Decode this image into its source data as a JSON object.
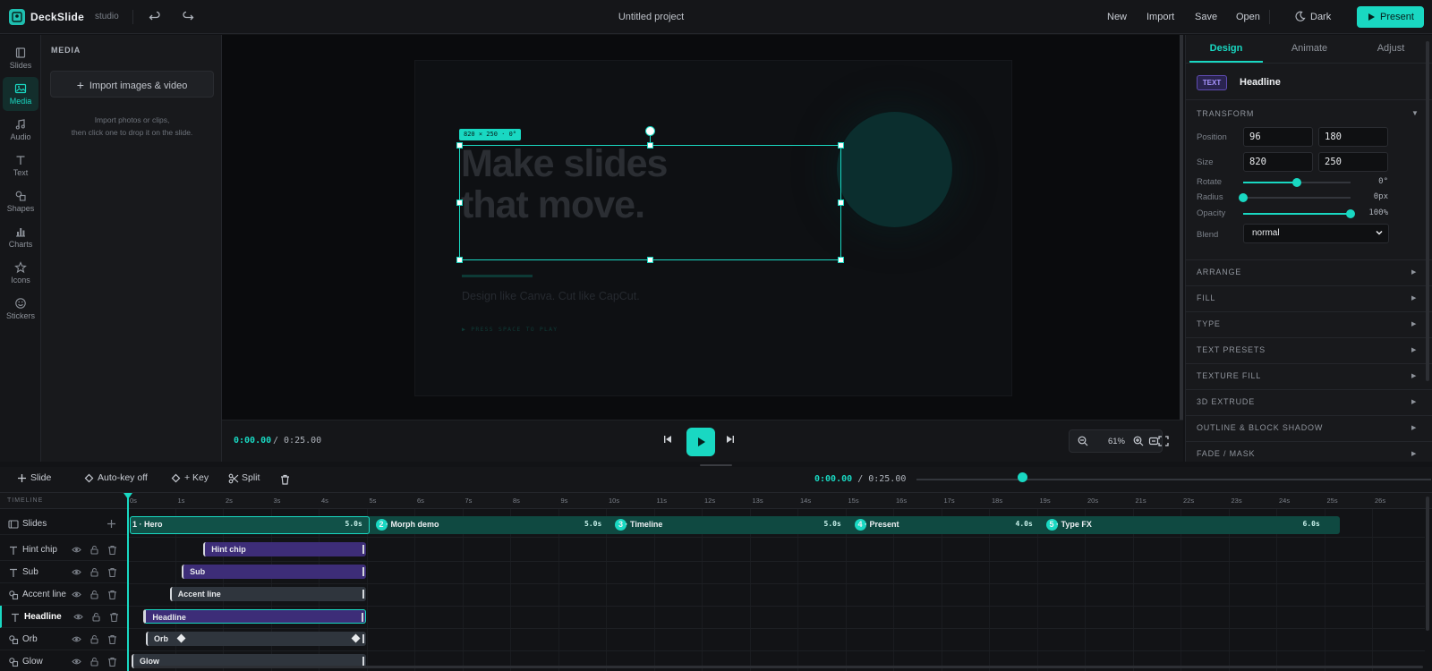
{
  "app": {
    "brand": "DeckSlide",
    "brand_sub": "studio",
    "project_title": "Untitled project"
  },
  "topbar": {
    "new": "New",
    "import": "Import",
    "save": "Save",
    "open": "Open",
    "theme": "Dark",
    "present": "Present"
  },
  "rail": [
    {
      "label": "Slides",
      "icon": "slides-icon"
    },
    {
      "label": "Media",
      "icon": "image-icon",
      "active": true
    },
    {
      "label": "Audio",
      "icon": "music-icon"
    },
    {
      "label": "Text",
      "icon": "text-icon"
    },
    {
      "label": "Shapes",
      "icon": "shapes-icon"
    },
    {
      "label": "Charts",
      "icon": "chart-icon"
    },
    {
      "label": "Icons",
      "icon": "star-icon"
    },
    {
      "label": "Stickers",
      "icon": "smiley-icon"
    }
  ],
  "media": {
    "title": "MEDIA",
    "import_label": "Import images & video",
    "hint_line1": "Import photos or clips,",
    "hint_line2": "then click one to drop it on the slide."
  },
  "canvas": {
    "headline_line1": "Make slides",
    "headline_line2": "that move.",
    "subtitle": "Design like Canva. Cut like CapCut.",
    "hint_chip": "▶ PRESS SPACE TO PLAY",
    "size_tag": "820 × 250 · 0°"
  },
  "transport": {
    "current": "0:00.00",
    "total": "/ 0:25.00",
    "zoom": "61%"
  },
  "inspector": {
    "tabs": [
      "Design",
      "Animate",
      "Adjust"
    ],
    "active_tab": "Design",
    "element_badge": "TEXT",
    "element_name": "Headline",
    "transform_title": "TRANSFORM",
    "position_label": "Position",
    "pos_x": "96",
    "pos_y": "180",
    "size_label": "Size",
    "width": "820",
    "height": "250",
    "rotate_label": "Rotate",
    "rotate_value": "0°",
    "rotate_frac": 0.5,
    "radius_label": "Radius",
    "radius_value": "0px",
    "radius_frac": 0.0,
    "opacity_label": "Opacity",
    "opacity_value": "100%",
    "opacity_frac": 1.0,
    "blend_label": "Blend",
    "blend_value": "normal",
    "sections": [
      "ARRANGE",
      "FILL",
      "TYPE",
      "TEXT PRESETS",
      "TEXTURE FILL",
      "3D EXTRUDE",
      "OUTLINE & BLOCK SHADOW",
      "FADE / MASK"
    ]
  },
  "timeline_toolbar": {
    "add_slide": "Slide",
    "autokey": "Auto-key off",
    "add_key": "+ Key",
    "split": "Split",
    "current": "0:00.00",
    "total": "/ 0:25.00"
  },
  "timeline": {
    "title": "TIMELINE",
    "ticks": [
      "0s",
      "1s",
      "2s",
      "3s",
      "4s",
      "5s",
      "6s",
      "7s",
      "8s",
      "9s",
      "10s",
      "11s",
      "12s",
      "13s",
      "14s",
      "15s",
      "16s",
      "17s",
      "18s",
      "19s",
      "20s",
      "21s",
      "22s",
      "23s",
      "24s",
      "25s",
      "26s"
    ],
    "slides_label": "Slides",
    "slides": [
      {
        "name": "1 · Hero",
        "duration": "5.0s"
      },
      {
        "name": "2 · Morph demo",
        "duration": "5.0s"
      },
      {
        "name": "3 · Timeline",
        "duration": "5.0s"
      },
      {
        "name": "4 · Present",
        "duration": "4.0s"
      },
      {
        "name": "5 · Type FX",
        "duration": "6.0s"
      }
    ],
    "tracks": [
      {
        "label": "Hint chip",
        "clip": "Hint chip",
        "color": "purple",
        "start": 1.5,
        "end": 4.9
      },
      {
        "label": "Sub",
        "clip": "Sub",
        "color": "purple",
        "start": 1.05,
        "end": 4.9
      },
      {
        "label": "Accent line",
        "clip": "Accent line",
        "color": "slate",
        "start": 0.8,
        "end": 4.9
      },
      {
        "label": "Headline",
        "clip": "Headline",
        "color": "purple",
        "start": 0.25,
        "end": 4.9,
        "active": true
      },
      {
        "label": "Orb",
        "clip": "Orb",
        "color": "slate",
        "start": 0.3,
        "end": 4.9
      },
      {
        "label": "Glow",
        "clip": "Glow",
        "color": "slate",
        "start": 0.0,
        "end": 4.9
      }
    ]
  },
  "colors": {
    "accent": "#19d8c2",
    "purple_clip": "#3d2d78",
    "slate_clip": "#2f353d"
  }
}
